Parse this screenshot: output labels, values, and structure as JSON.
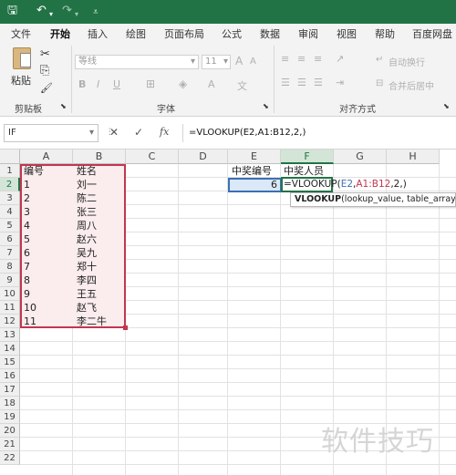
{
  "titlebar": {
    "save_icon": "🖫",
    "undo_icon": "↶",
    "redo_icon": "↷",
    "quick_icon": "⩡"
  },
  "menu": [
    "文件",
    "开始",
    "插入",
    "绘图",
    "页面布局",
    "公式",
    "数据",
    "审阅",
    "视图",
    "帮助",
    "百度网盘"
  ],
  "ribbon": {
    "paste_label": "粘贴",
    "cut_icon": "✂",
    "copy_icon": "⎘",
    "painter_icon": "🖌",
    "font_name": "等线",
    "font_size": "11",
    "grow_font": "A",
    "shrink_font": "A",
    "bold": "B",
    "italic": "I",
    "underline": "U",
    "border_icon": "⊞",
    "fill_icon": "◈",
    "font_color_icon": "A",
    "phonetic_icon": "文",
    "wrap_label": "自动换行",
    "merge_label": "合并后居中",
    "groups": {
      "clipboard": "剪贴板",
      "font": "字体",
      "alignment": "对齐方式"
    }
  },
  "formula_bar": {
    "name_box": "IF",
    "cancel_icon": "✕",
    "enter_icon": "✓",
    "fx_icon": "fx",
    "formula": "=VLOOKUP(E2,A1:B12,2,)"
  },
  "columns": [
    "A",
    "B",
    "C",
    "D",
    "E",
    "F",
    "G",
    "H"
  ],
  "rows": [
    "1",
    "2",
    "3",
    "4",
    "5",
    "6",
    "7",
    "8",
    "9",
    "10",
    "11",
    "12",
    "13",
    "14",
    "15",
    "16",
    "17",
    "18",
    "19",
    "20",
    "21",
    "22"
  ],
  "table": {
    "header": [
      "编号",
      "姓名"
    ],
    "ids": [
      "1",
      "2",
      "3",
      "4",
      "5",
      "6",
      "7",
      "8",
      "9",
      "10",
      "11"
    ],
    "names": [
      "刘一",
      "陈二",
      "张三",
      "周八",
      "赵六",
      "吴九",
      "郑十",
      "李四",
      "王五",
      "赵飞",
      "李二牛"
    ]
  },
  "lookup": {
    "e1": "中奖编号",
    "f1": "中奖人员",
    "e2": "6",
    "f2_prefix": "=VLOOKUP(",
    "f2_ref1": "E2",
    "f2_comma1": ",",
    "f2_ref2": "A1:B12",
    "f2_suffix": ",2,)"
  },
  "tooltip": {
    "fn": "VLOOKUP",
    "args": "(lookup_value, table_array, c"
  },
  "watermark": "软件技巧"
}
